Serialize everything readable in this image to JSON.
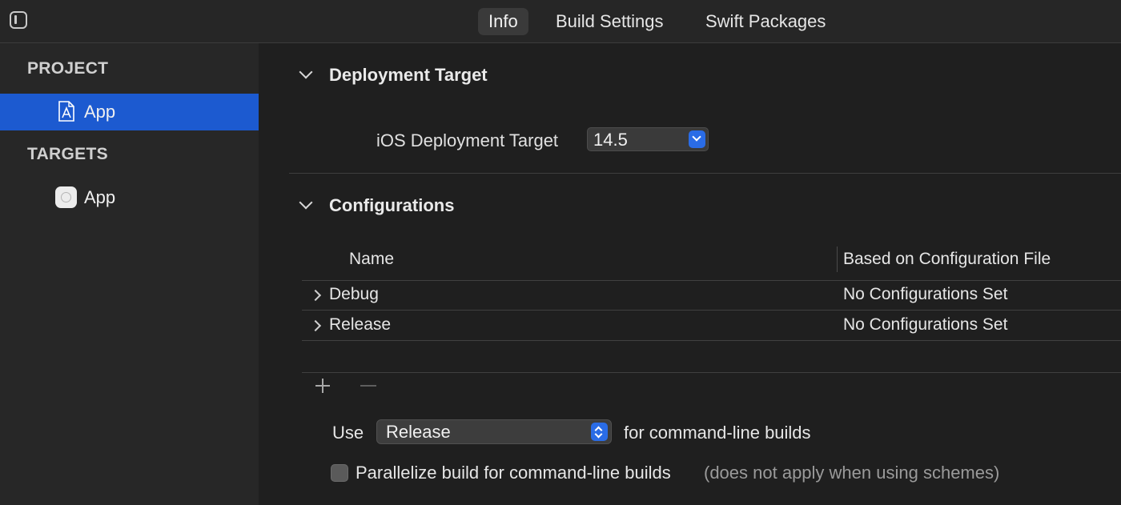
{
  "toolbar": {
    "tabs": [
      {
        "label": "Info",
        "active": true
      },
      {
        "label": "Build Settings",
        "active": false
      },
      {
        "label": "Swift Packages",
        "active": false
      }
    ]
  },
  "sidebar": {
    "project_heading": "PROJECT",
    "project_item": "App",
    "targets_heading": "TARGETS",
    "target_item": "App"
  },
  "deployment": {
    "title": "Deployment Target",
    "label": "iOS Deployment Target",
    "value": "14.5"
  },
  "configurations": {
    "title": "Configurations",
    "columns": [
      "Name",
      "Based on Configuration File"
    ],
    "rows": [
      {
        "name": "Debug",
        "file": "No Configurations Set"
      },
      {
        "name": "Release",
        "file": "No Configurations Set"
      }
    ],
    "use_label": "Use",
    "use_value": "Release",
    "use_suffix": "for command-line builds",
    "parallelize_label": "Parallelize build for command-line builds",
    "parallelize_note": "(does not apply when using schemes)"
  },
  "colors": {
    "background": "#1f1f1f",
    "sidebar": "#272727",
    "selection": "#1c5ad0",
    "accent": "#2a6ce6"
  }
}
